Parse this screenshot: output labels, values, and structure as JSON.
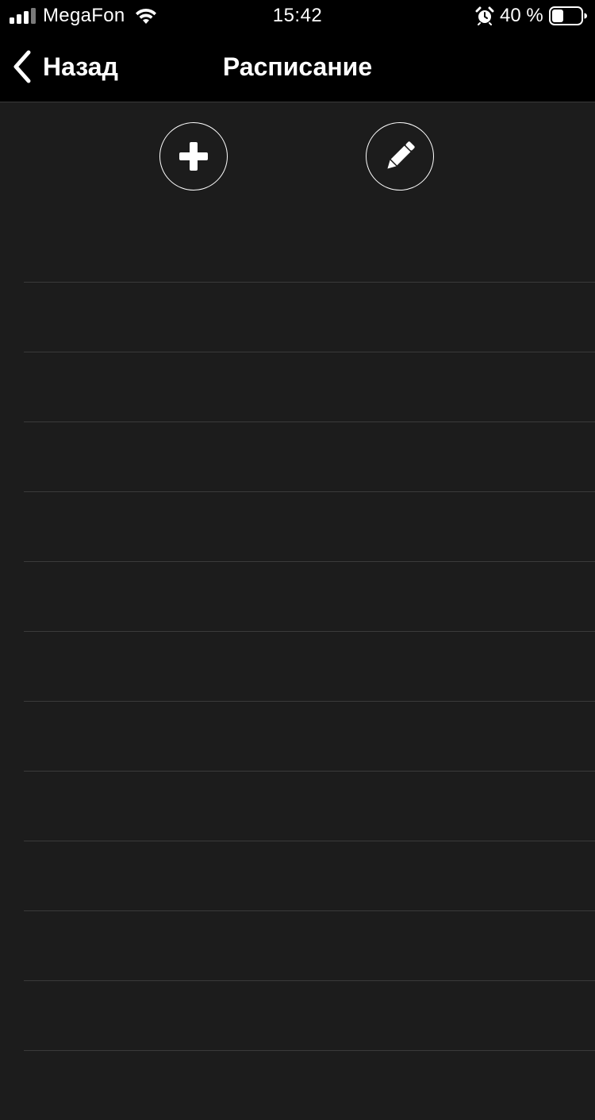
{
  "status_bar": {
    "carrier": "MegaFon",
    "time": "15:42",
    "battery_percent": "40 %",
    "battery_level": 0.4,
    "icons": [
      "signal-icon",
      "wifi-icon",
      "alarm-icon",
      "battery-icon"
    ]
  },
  "nav": {
    "back_label": "Назад",
    "title": "Расписание",
    "back_icon": "chevron-left-icon"
  },
  "toolbar": {
    "add_icon": "plus-icon",
    "edit_icon": "pencil-icon"
  },
  "schedule": {
    "rows": [
      "",
      "",
      "",
      "",
      "",
      "",
      "",
      "",
      "",
      "",
      "",
      ""
    ]
  },
  "colors": {
    "background": "#1c1c1c",
    "bar": "#000000",
    "separator": "#3a3a3a",
    "foreground": "#ffffff"
  }
}
